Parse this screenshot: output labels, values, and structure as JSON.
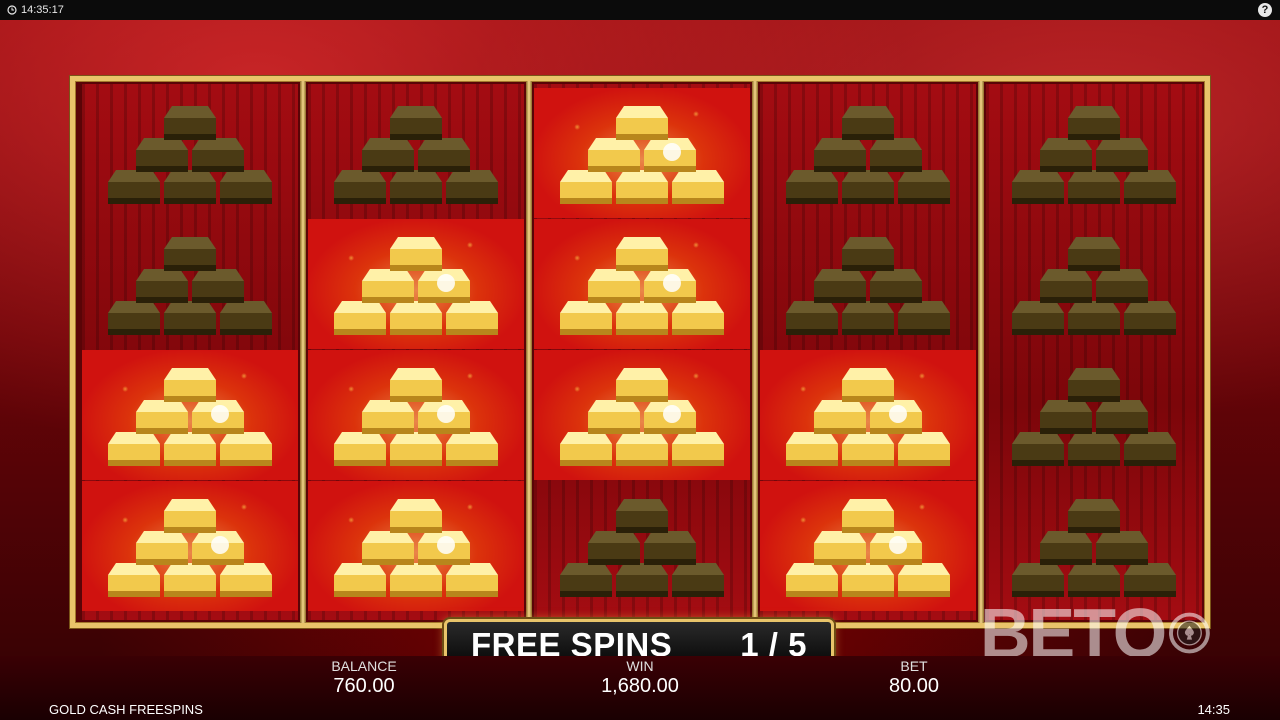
{
  "topbar": {
    "time": "14:35:17"
  },
  "banner": {
    "label": "FREE SPINS",
    "counter": "1 / 5"
  },
  "stats": {
    "balance": {
      "label": "BALANCE",
      "value": "760.00"
    },
    "win": {
      "label": "WIN",
      "value": "1,680.00"
    },
    "bet": {
      "label": "BET",
      "value": "80.00"
    }
  },
  "game_name": "GOLD CASH FREESPINS",
  "bottom_time": "14:35",
  "watermark": "BETO",
  "reels": [
    [
      "dark-gold-bars",
      "dark-gold-bars",
      "shiny-gold-bars",
      "shiny-gold-bars"
    ],
    [
      "dark-gold-bars",
      "shiny-gold-bars",
      "shiny-gold-bars",
      "shiny-gold-bars"
    ],
    [
      "shiny-gold-bars",
      "shiny-gold-bars",
      "shiny-gold-bars",
      "dark-gold-bars"
    ],
    [
      "dark-gold-bars",
      "dark-gold-bars",
      "shiny-gold-bars",
      "shiny-gold-bars"
    ],
    [
      "dark-gold-bars",
      "dark-gold-bars",
      "dark-gold-bars",
      "dark-gold-bars"
    ]
  ],
  "colors": {
    "frame_gold": "#e9c46a",
    "reel_red": "#a40c12",
    "dark_bar": "#4a3a14",
    "gold_bar": "#f2c94c"
  }
}
